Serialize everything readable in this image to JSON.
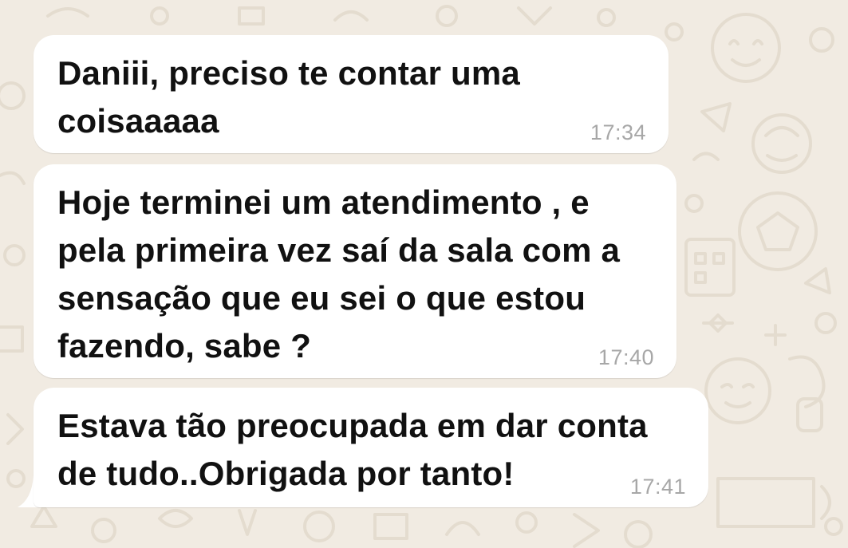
{
  "chat": {
    "messages": [
      {
        "text": "Daniii, preciso te contar uma\ncoisaaaaa",
        "time": "17:34"
      },
      {
        "text": "Hoje terminei um atendimento , e\npela primeira vez saí da sala com a\nsensação que eu sei o que estou\nfazendo, sabe ?",
        "time": "17:40"
      },
      {
        "text": "Estava tão preocupada em dar conta\nde tudo..Obrigada por tanto!",
        "time": "17:41"
      }
    ]
  },
  "colors": {
    "wallpaper": "#f1ebe2",
    "doodle_stroke": "#e4dccf",
    "bubble": "#ffffff",
    "message_text": "#111111",
    "timestamp": "#a7a7a7"
  },
  "icons": [
    "chat-wallpaper-doodles"
  ]
}
